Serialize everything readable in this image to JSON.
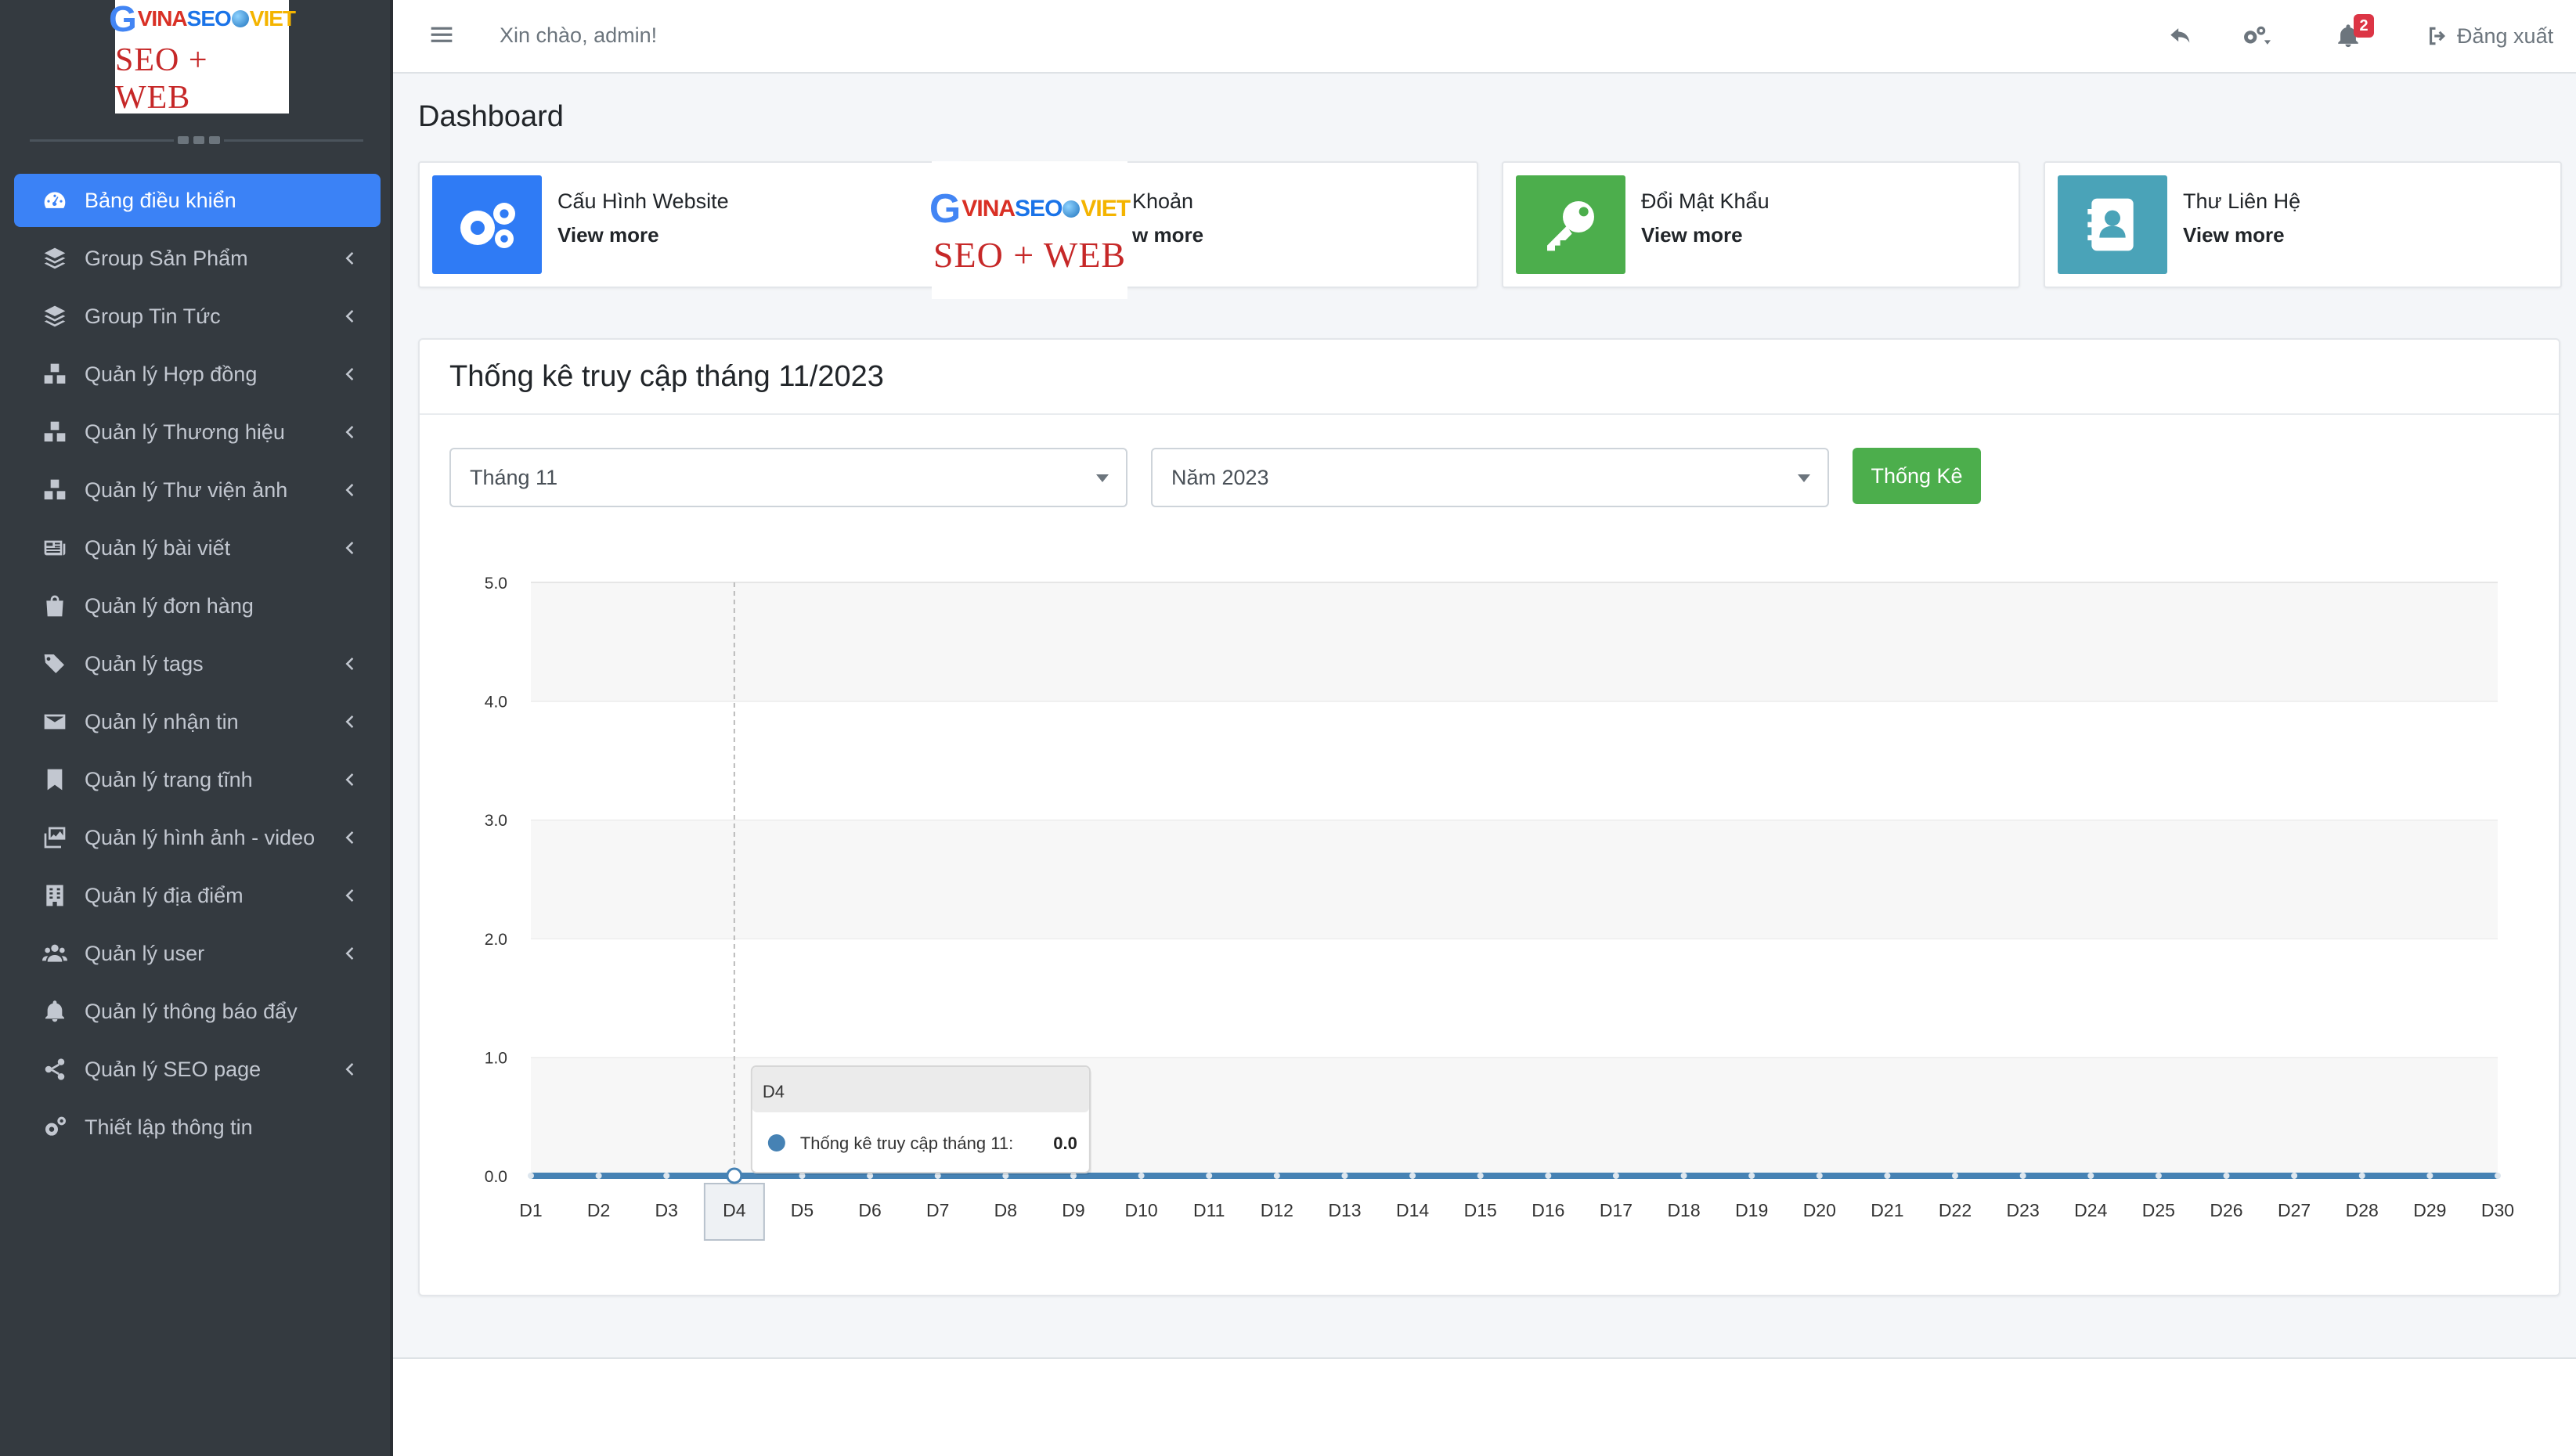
{
  "logo": {
    "letter": "G",
    "vina": "VINA",
    "seo": "SEO",
    "viet": "VIET",
    "bottom": "SEO + WEB"
  },
  "sidebar": {
    "items": [
      {
        "label": "Bảng điều khiển",
        "icon": "dashboard-icon",
        "active": true,
        "chevron": false
      },
      {
        "label": "Group Sản Phẩm",
        "icon": "layers-icon",
        "chevron": true
      },
      {
        "label": "Group Tin Tức",
        "icon": "layers-icon",
        "chevron": true
      },
      {
        "label": "Quản lý Hợp đồng",
        "icon": "boxes-icon",
        "chevron": true
      },
      {
        "label": "Quản lý Thương hiệu",
        "icon": "boxes-icon",
        "chevron": true
      },
      {
        "label": "Quản lý Thư viện ảnh",
        "icon": "boxes-icon",
        "chevron": true
      },
      {
        "label": "Quản lý bài viết",
        "icon": "newspaper-icon",
        "chevron": true
      },
      {
        "label": "Quản lý đơn hàng",
        "icon": "shopping-bag-icon",
        "chevron": false
      },
      {
        "label": "Quản lý tags",
        "icon": "tags-icon",
        "chevron": true
      },
      {
        "label": "Quản lý nhận tin",
        "icon": "envelope-icon",
        "chevron": true
      },
      {
        "label": "Quản lý trang tĩnh",
        "icon": "bookmark-icon",
        "chevron": true
      },
      {
        "label": "Quản lý hình ảnh - video",
        "icon": "photo-video-icon",
        "chevron": true
      },
      {
        "label": "Quản lý địa điểm",
        "icon": "building-icon",
        "chevron": true
      },
      {
        "label": "Quản lý user",
        "icon": "users-icon",
        "chevron": true
      },
      {
        "label": "Quản lý thông báo đẩy",
        "icon": "bell-icon",
        "chevron": false
      },
      {
        "label": "Quản lý SEO page",
        "icon": "share-icon",
        "chevron": true
      },
      {
        "label": "Thiết lập thông tin",
        "icon": "cogs-icon",
        "chevron": false
      }
    ]
  },
  "topbar": {
    "greeting": "Xin chào, admin!",
    "notification_count": "2",
    "logout_label": "Đăng xuất"
  },
  "page": {
    "title": "Dashboard"
  },
  "cards": [
    {
      "title": "Cấu Hình Website",
      "link": "View more",
      "color": "#2f7bf5",
      "icon": "cogs-icon"
    },
    {
      "title": "Khoản",
      "link": "w more",
      "color": "#dc3545",
      "icon": "user-icon"
    },
    {
      "title": "Đổi Mật Khẩu",
      "link": "View more",
      "color": "#4cae4c",
      "icon": "key-icon"
    },
    {
      "title": "Thư Liên Hệ",
      "link": "View more",
      "color": "#4aa3b8",
      "icon": "contact-icon"
    }
  ],
  "stats": {
    "title": "Thống kê truy cập tháng 11/2023",
    "month_select": "Tháng 11",
    "year_select": "Năm 2023",
    "button_label": "Thống Kê"
  },
  "chart_data": {
    "type": "line",
    "categories": [
      "D1",
      "D2",
      "D3",
      "D4",
      "D5",
      "D6",
      "D7",
      "D8",
      "D9",
      "D10",
      "D11",
      "D12",
      "D13",
      "D14",
      "D15",
      "D16",
      "D17",
      "D18",
      "D19",
      "D20",
      "D21",
      "D22",
      "D23",
      "D24",
      "D25",
      "D26",
      "D27",
      "D28",
      "D29",
      "D30"
    ],
    "series": [
      {
        "name": "Thống kê truy cập tháng 11",
        "values": [
          0,
          0,
          0,
          0,
          0,
          0,
          0,
          0,
          0,
          0,
          0,
          0,
          0,
          0,
          0,
          0,
          0,
          0,
          0,
          0,
          0,
          0,
          0,
          0,
          0,
          0,
          0,
          0,
          0,
          0
        ]
      }
    ],
    "y_ticks": [
      "0.0",
      "1.0",
      "2.0",
      "3.0",
      "4.0",
      "5.0"
    ],
    "ylim": [
      0,
      5
    ],
    "color": "#4682b4",
    "tooltip": {
      "category": "D4",
      "label": "Thống kê truy cập tháng 11:",
      "value": "0.0"
    },
    "grid": "alternating-bands",
    "legend": "none"
  }
}
